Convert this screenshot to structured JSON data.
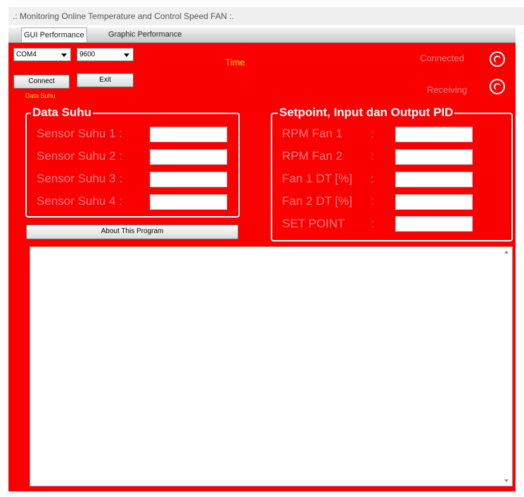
{
  "window": {
    "title": ".: Monitoring Online Temperature and Control Speed FAN :."
  },
  "tabs": [
    {
      "label": "GUI Performance",
      "active": true
    },
    {
      "label": "Graphic Performance",
      "active": false
    }
  ],
  "serial": {
    "port_value": "COM4",
    "baud_value": "9600",
    "connect_label": "Connect",
    "exit_label": "Exit"
  },
  "time_label": "Time",
  "small_label": "Data Suhu",
  "status": {
    "connected_label": "Connected",
    "receiving_label": "Receiving"
  },
  "data_suhu": {
    "title": "Data Suhu",
    "fields": [
      "Sensor Suhu 1 :",
      "Sensor Suhu 2 :",
      "Sensor Suhu 3 :",
      "Sensor Suhu 4 :"
    ]
  },
  "pid": {
    "title": "Setpoint, Input dan Output PID",
    "fields": [
      "RPM Fan 1",
      "RPM Fan 2",
      "Fan 1 DT [%]",
      "Fan 2 DT [%]",
      "SET POINT"
    ],
    "separator": ":"
  },
  "about_label": "About This Program",
  "log": {
    "content": ""
  },
  "colors": {
    "background": "#fa0000",
    "label_text": "#ff7f7f",
    "time_text": "#ffd700",
    "group_border": "#ffffff"
  }
}
